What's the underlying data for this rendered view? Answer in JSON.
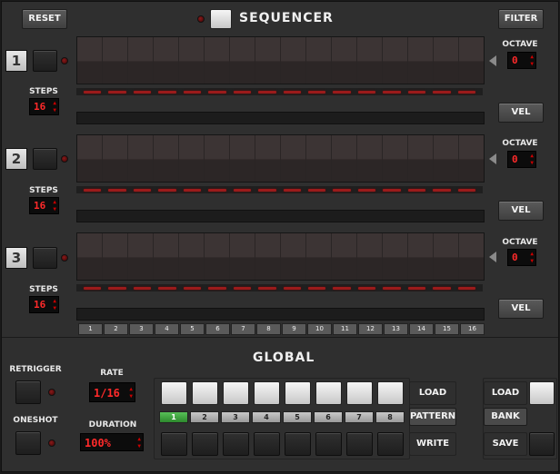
{
  "header": {
    "reset_label": "RESET",
    "title": "SEQUENCER",
    "filter_label": "FILTER"
  },
  "tracks": [
    {
      "number": "1",
      "steps_label": "STEPS",
      "steps_value": "16",
      "octave_label": "OCTAVE",
      "octave_value": "0",
      "vel_label": "VEL"
    },
    {
      "number": "2",
      "steps_label": "STEPS",
      "steps_value": "16",
      "octave_label": "OCTAVE",
      "octave_value": "0",
      "vel_label": "VEL"
    },
    {
      "number": "3",
      "steps_label": "STEPS",
      "steps_value": "16",
      "octave_label": "OCTAVE",
      "octave_value": "0",
      "vel_label": "VEL"
    }
  ],
  "step_numbers": [
    "1",
    "2",
    "3",
    "4",
    "5",
    "6",
    "7",
    "8",
    "9",
    "10",
    "11",
    "12",
    "13",
    "14",
    "15",
    "16"
  ],
  "global": {
    "title": "GLOBAL",
    "retrigger_label": "RETRIGGER",
    "oneshot_label": "ONESHOT",
    "rate_label": "RATE",
    "rate_value": "1/16",
    "duration_label": "DURATION",
    "duration_value": "100%",
    "load_label": "LOAD",
    "pattern_label": "PATTERN",
    "write_label": "WRITE",
    "pattern_numbers": [
      "1",
      "2",
      "3",
      "4",
      "5",
      "6",
      "7",
      "8"
    ],
    "active_pattern": "1",
    "bank_load_label": "LOAD",
    "bank_label": "BANK",
    "bank_save_label": "SAVE"
  },
  "colors": {
    "led_red": "#9b1b1b",
    "lcd_red": "#ff2a2a",
    "active_green": "#3fa83f"
  }
}
